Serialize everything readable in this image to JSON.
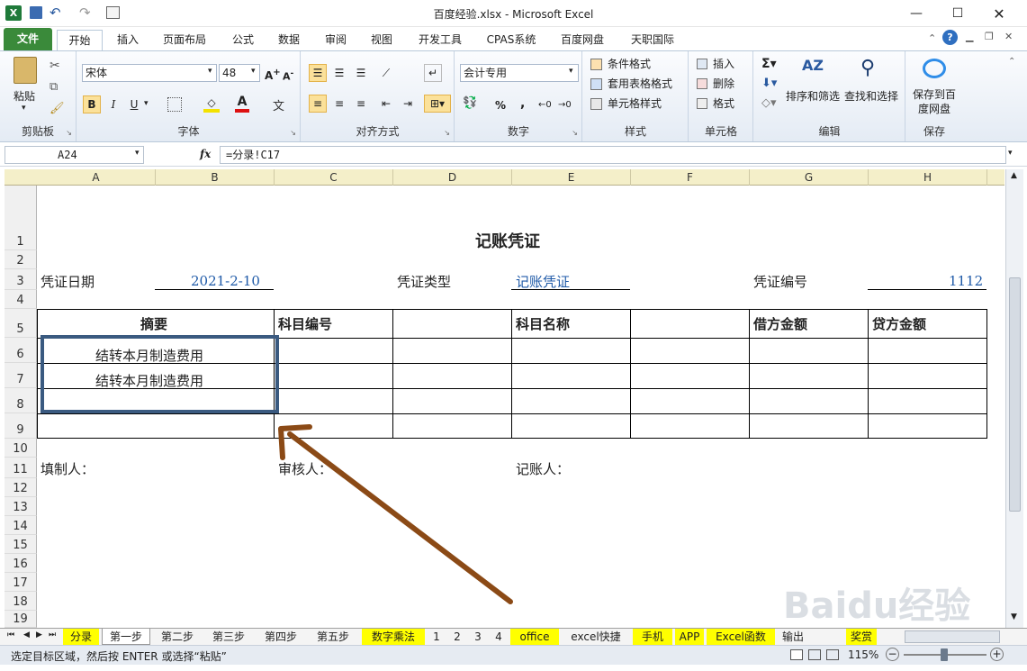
{
  "window": {
    "title": "百度经验.xlsx - Microsoft Excel"
  },
  "ribbon_tabs": [
    "文件",
    "开始",
    "插入",
    "页面布局",
    "公式",
    "数据",
    "审阅",
    "视图",
    "开发工具",
    "CPAS系统",
    "百度网盘",
    "天职国际"
  ],
  "clipboard": {
    "paste": "粘贴",
    "label": "剪贴板"
  },
  "font": {
    "name": "宋体",
    "size": "48",
    "bold": "B",
    "italic": "I",
    "underline": "U",
    "label": "字体"
  },
  "alignment": {
    "label": "对齐方式"
  },
  "number": {
    "format": "会计专用",
    "percent": "%",
    "comma": ",",
    "label": "数字"
  },
  "styles": {
    "conditional": "条件格式",
    "table": "套用表格格式",
    "cell": "单元格样式",
    "label": "样式"
  },
  "cells": {
    "insert": "插入",
    "delete": "删除",
    "format": "格式",
    "label": "单元格"
  },
  "editing": {
    "sort": "排序和筛选",
    "find": "查找和选择",
    "label": "编辑"
  },
  "save": {
    "button": "保存到百度网盘",
    "label": "保存"
  },
  "formula_bar": {
    "name_box": "A24",
    "fx": "fx",
    "formula": "=分录!C17"
  },
  "columns": [
    "A",
    "B",
    "C",
    "D",
    "E",
    "F",
    "G",
    "H"
  ],
  "rows": [
    "1",
    "2",
    "3",
    "4",
    "5",
    "6",
    "7",
    "8",
    "9",
    "10",
    "11",
    "12",
    "13",
    "14",
    "15",
    "16",
    "17",
    "18",
    "19"
  ],
  "sheet": {
    "title": "记账凭证",
    "date_label": "凭证日期",
    "date_value": "2021-2-10",
    "type_label": "凭证类型",
    "type_value": "记账凭证",
    "number_label": "凭证编号",
    "number_value": "1112",
    "headers": {
      "summary": "摘要",
      "account_code": "科目编号",
      "account_name": "科目名称",
      "debit": "借方金额",
      "credit": "贷方金额"
    },
    "rows": [
      "结转本月制造费用",
      "结转本月制造费用"
    ],
    "preparer": "填制人：",
    "reviewer": "审核人：",
    "bookkeeper": "记账人："
  },
  "sheet_tabs": [
    "分录",
    "第一步",
    "第二步",
    "第三步",
    "第四步",
    "第五步",
    "数字乘法",
    "1",
    "2",
    "3",
    "4",
    "office",
    "excel快捷",
    "手机",
    "APP",
    "Excel函数",
    "输出",
    "奖赏"
  ],
  "status": {
    "message": "选定目标区域，然后按 ENTER 或选择“粘贴”",
    "zoom": "115%"
  },
  "annotation": {
    "highlight_color": "#3a5a80",
    "arrow_color": "#8b4a16"
  },
  "watermark": "Baidu经验"
}
